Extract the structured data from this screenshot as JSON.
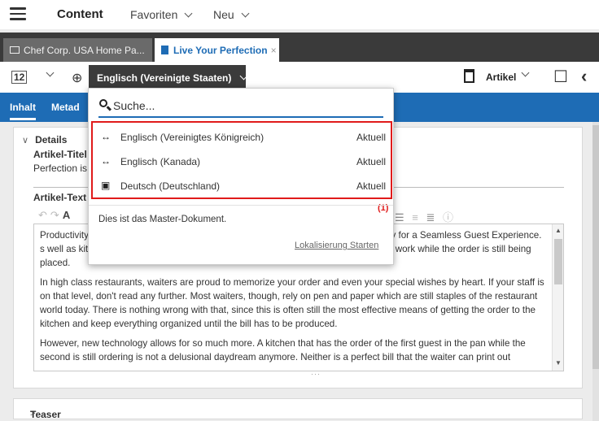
{
  "menubar": {
    "content_label": "Content",
    "favoriten_label": "Favoriten",
    "neu_label": "Neu"
  },
  "tabs": [
    {
      "label": "Chef Corp. USA Home Pa...",
      "active": false
    },
    {
      "label": "Live Your Perfection",
      "active": true,
      "close": "×"
    }
  ],
  "toolbar": {
    "version_label": "12",
    "language_selected": "Englisch (Vereinigte Staaten)",
    "type_label": "Artikel"
  },
  "subtabs": {
    "inhalt": "Inhalt",
    "metadaten": "Metad"
  },
  "details": {
    "section_label": "Details",
    "artikel_titel_label": "Artikel-Titel",
    "artikel_titel_value": "Perfection is",
    "artikel_text_label": "Artikel-Text",
    "editor_paragraphs": [
      "Productivity                                                                                              ed Technology for a Seamless Guest Experience.                                                                                             s well as kitchen order display and inquire devices enables your kitchen staff to go to work while the order is still being placed.",
      "In high class restaurants, waiters are proud to memorize your order and even your special wishes by heart. If your staff is on that level, don't read any further. Most waiters, though, rely on pen and paper which are still staples of the restaurant world today. There is nothing wrong with that, since this is often still the most effective means of getting the order to the kitchen and keep everything organized until the bill has to be produced.",
      "However, new technology allows for so much more. A kitchen that has the order of the first guest in the pan while the second is still ordering is not a delusional daydream anymore. Neither is a perfect bill that the waiter can print out"
    ]
  },
  "teaser": {
    "label": "Teaser"
  },
  "dropdown": {
    "search_placeholder": "Suche...",
    "items": [
      {
        "icon": "translate-arrows-icon",
        "name": "Englisch (Vereinigtes Königreich)",
        "status": "Aktuell"
      },
      {
        "icon": "translate-arrows-icon",
        "name": "Englisch (Kanada)",
        "status": "Aktuell"
      },
      {
        "icon": "master-language-icon",
        "name": "Deutsch (Deutschland)",
        "status": "Aktuell"
      }
    ],
    "annotation": "(1)",
    "master_text": "Dies ist das Master-Dokument.",
    "start_link": "Lokalisierung Starten"
  },
  "colors": {
    "accent": "#1e6cb5",
    "dark": "#3a3a3a",
    "highlight": "#e01b1b"
  }
}
